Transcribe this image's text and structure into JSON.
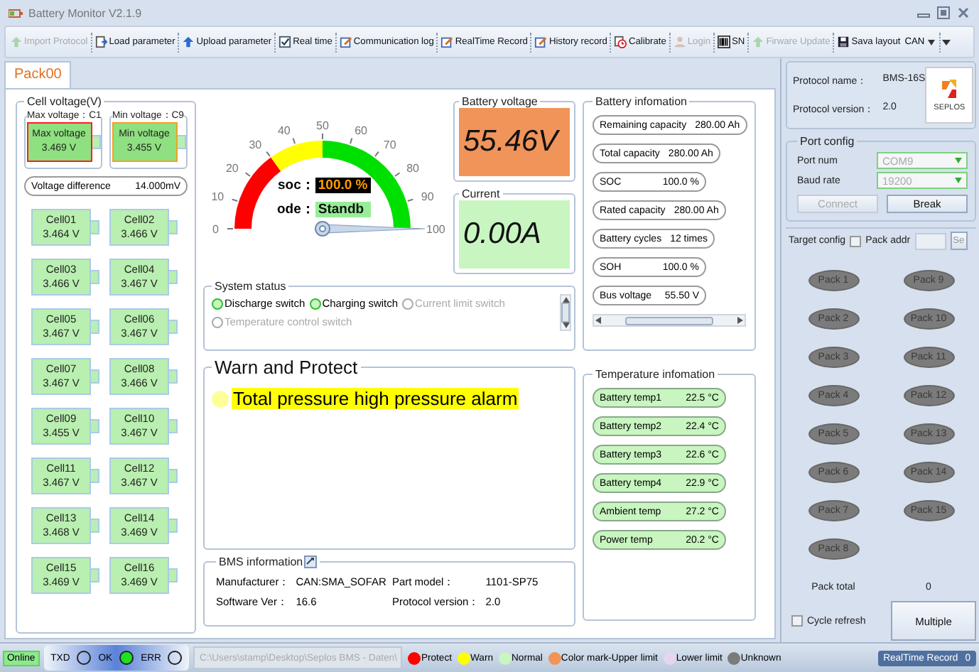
{
  "window": {
    "title": "Battery Monitor V2.1.9"
  },
  "toolbar": {
    "items": [
      {
        "label": "Import Protocol",
        "disabled": true
      },
      {
        "label": "Load parameter",
        "disabled": false
      },
      {
        "label": "Upload parameter",
        "disabled": false
      },
      {
        "label": "Real time",
        "disabled": false
      },
      {
        "label": "Communication log",
        "disabled": false
      },
      {
        "label": "RealTime Record",
        "disabled": false
      },
      {
        "label": "History record",
        "disabled": false
      },
      {
        "label": "Calibrate",
        "disabled": false
      },
      {
        "label": "Login",
        "disabled": true
      },
      {
        "label": "SN",
        "disabled": false
      },
      {
        "label": "Firware Update",
        "disabled": true
      },
      {
        "label": "Sava layout",
        "disabled": false
      }
    ],
    "protocol_select": {
      "value": "CAN"
    }
  },
  "tabs": [
    {
      "label": "Pack00",
      "selected": true
    }
  ],
  "cell_voltage": {
    "title": "Cell voltage(V)",
    "extremes": [
      {
        "kind": "max",
        "title": "Max voltage：C1",
        "label": "Max voltage",
        "value": "3.469 V"
      },
      {
        "kind": "min",
        "title": "Min voltage：C9",
        "label": "Min voltage",
        "value": "3.455 V"
      }
    ],
    "difference": {
      "label": "Voltage difference",
      "value": "14.000mV"
    },
    "cells": [
      {
        "name": "Cell01",
        "value": "3.464 V"
      },
      {
        "name": "Cell02",
        "value": "3.466 V"
      },
      {
        "name": "Cell03",
        "value": "3.466 V"
      },
      {
        "name": "Cell04",
        "value": "3.467 V"
      },
      {
        "name": "Cell05",
        "value": "3.467 V"
      },
      {
        "name": "Cell06",
        "value": "3.467 V"
      },
      {
        "name": "Cell07",
        "value": "3.467 V"
      },
      {
        "name": "Cell08",
        "value": "3.466 V"
      },
      {
        "name": "Cell09",
        "value": "3.455 V"
      },
      {
        "name": "Cell10",
        "value": "3.467 V"
      },
      {
        "name": "Cell11",
        "value": "3.467 V"
      },
      {
        "name": "Cell12",
        "value": "3.467 V"
      },
      {
        "name": "Cell13",
        "value": "3.468 V"
      },
      {
        "name": "Cell14",
        "value": "3.469 V"
      },
      {
        "name": "Cell15",
        "value": "3.469 V"
      },
      {
        "name": "Cell16",
        "value": "3.469 V"
      }
    ]
  },
  "gauge": {
    "ticks": [
      "0",
      "10",
      "20",
      "30",
      "40",
      "50",
      "60",
      "70",
      "80",
      "90",
      "100"
    ],
    "level": 1,
    "soc": {
      "label": "soc：",
      "value": "100.0 %"
    },
    "mode": {
      "label": "ode：",
      "value": "Standb"
    }
  },
  "battery_voltage": {
    "title": "Battery voltage",
    "value": "55.46V"
  },
  "current": {
    "title": "Current",
    "value": "0.00A"
  },
  "system_status": {
    "title": "System status",
    "switches": [
      {
        "label": "Discharge switch",
        "on": true
      },
      {
        "label": "Charging switch",
        "on": true
      },
      {
        "label": "Current limit switch",
        "on": false
      },
      {
        "label": "Temperature control switch",
        "on": false
      }
    ]
  },
  "warn_protect": {
    "title": "Warn and Protect",
    "alarms": [
      {
        "text": "Total pressure high pressure alarm",
        "kind": "warn"
      }
    ]
  },
  "bms_information": {
    "title": "BMS information",
    "fields": [
      {
        "label": "Manufacturer：",
        "value": "CAN:SMA_SOFAR"
      },
      {
        "label": "Part model：",
        "value": "1101-SP75"
      },
      {
        "label": "Software Ver：",
        "value": "16.6"
      },
      {
        "label": "Protocol version：",
        "value": "2.0"
      }
    ]
  },
  "battery_information": {
    "title": "Battery infomation",
    "items": [
      {
        "label": "Remaining capacity",
        "value": "280.00 Ah"
      },
      {
        "label": "Total capacity",
        "value": "280.00 Ah"
      },
      {
        "label": "SOC",
        "value": "100.0 %"
      },
      {
        "label": "Rated capacity",
        "value": "280.00 Ah"
      },
      {
        "label": "Battery cycles",
        "value": "12 times"
      },
      {
        "label": "SOH",
        "value": "100.0 %"
      },
      {
        "label": "Bus voltage",
        "value": "55.50 V"
      }
    ]
  },
  "temperature_information": {
    "title": "Temperature infomation",
    "items": [
      {
        "label": "Battery temp1",
        "value": "22.5 °C"
      },
      {
        "label": "Battery temp2",
        "value": "22.4 °C"
      },
      {
        "label": "Battery temp3",
        "value": "22.6 °C"
      },
      {
        "label": "Battery temp4",
        "value": "22.9 °C"
      },
      {
        "label": "Ambient temp",
        "value": "27.2 °C"
      },
      {
        "label": "Power temp",
        "value": "20.2 °C"
      }
    ]
  },
  "side": {
    "protocol": [
      {
        "label": "Protocol name：",
        "value": "BMS-16S"
      },
      {
        "label": "Protocol version：",
        "value": "2.0"
      }
    ],
    "logo_text": "SEPLOS",
    "port_config": {
      "title": "Port config",
      "fields": [
        {
          "label": "Port num",
          "value": "COM9"
        },
        {
          "label": "Baud rate",
          "value": "19200"
        }
      ],
      "buttons": [
        {
          "label": "Connect",
          "disabled": true
        },
        {
          "label": "Break",
          "disabled": false
        }
      ]
    },
    "target_config": {
      "title": "Target config",
      "pack_addr": {
        "label": "Pack addr",
        "checked": false
      },
      "set_button": "Se",
      "packs": [
        "Pack 1",
        "Pack 2",
        "Pack 3",
        "Pack 4",
        "Pack 5",
        "Pack 6",
        "Pack 7",
        "Pack 8",
        "Pack 9",
        "Pack 10",
        "Pack 11",
        "Pack 12",
        "Pack 13",
        "Pack 14",
        "Pack 15"
      ],
      "pack_total": {
        "label": "Pack total",
        "value": "0"
      },
      "cycle_refresh": {
        "label": "Cycle refresh",
        "checked": false
      },
      "multiple_button": "Multiple"
    }
  },
  "status_bar": {
    "connection": "Online",
    "indicators": [
      {
        "label": "TXD",
        "on": false
      },
      {
        "label": "OK",
        "on": true
      },
      {
        "label": "ERR",
        "on": false
      }
    ],
    "path": "C:\\Users\\stamp\\Desktop\\Seplos BMS - Daten\\",
    "legend": [
      {
        "label": "Protect",
        "color": "#ff0000"
      },
      {
        "label": "Warn",
        "color": "#ffff00"
      },
      {
        "label": "Normal",
        "color": "#c8f5c0"
      },
      {
        "label": "Color mark-Upper limit",
        "color": "#f0945a"
      },
      {
        "label": "Lower limit",
        "color": "#e6d5f0"
      },
      {
        "label": "Unknown",
        "color": "#7b7b7b"
      }
    ],
    "record": {
      "label": "RealTime Record",
      "value": "0"
    }
  }
}
